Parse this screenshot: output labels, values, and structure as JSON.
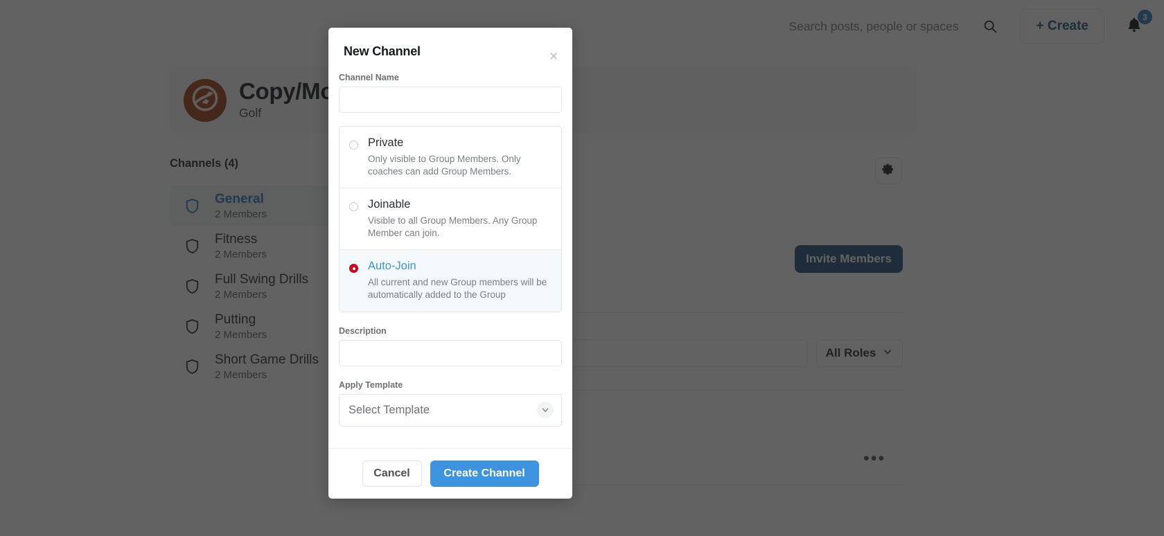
{
  "topbar": {
    "search_placeholder": "Search posts, people or spaces",
    "search_value": "",
    "search_icon": "search-icon",
    "create_label": "+ Create",
    "bell_icon": "bell-icon",
    "notification_count": "3",
    "badge_color": "#2c75b8"
  },
  "group": {
    "title": "Copy/Mov",
    "subtitle": "Golf",
    "logo_icon": "runner-logo-icon",
    "logo_color": "#a23c12"
  },
  "channels_panel": {
    "heading": "Channels (4)",
    "items": [
      {
        "name": "General",
        "members": "2 Members",
        "icon": "shield-icon",
        "active": true
      },
      {
        "name": "Fitness",
        "members": "2 Members",
        "icon": "shield-icon",
        "active": false
      },
      {
        "name": "Full Swing Drills",
        "members": "2 Members",
        "icon": "shield-icon",
        "active": false
      },
      {
        "name": "Putting",
        "members": "2 Members",
        "icon": "shield-icon",
        "active": false
      },
      {
        "name": "Short Game Drills",
        "members": "2 Members",
        "icon": "shield-icon",
        "active": false
      }
    ]
  },
  "members_panel": {
    "gear_icon": "gear-icon",
    "invite_label": "Invite Members",
    "invite_color": "#1f4e79",
    "search_value": "",
    "roles_label": "All Roles",
    "roles_chevron_icon": "chevron-down-icon",
    "row_menu_label": "•••"
  },
  "modal": {
    "title": "New Channel",
    "close_icon": "close-icon",
    "close_label": "×",
    "channel_name": {
      "label": "Channel Name",
      "value": "",
      "placeholder": ""
    },
    "visibility_options": [
      {
        "title": "Private",
        "description": "Only visible to Group Members. Only coaches can add Group Members.",
        "selected": false
      },
      {
        "title": "Joinable",
        "description": "Visible to all Group Members. Any Group Member can join.",
        "selected": false
      },
      {
        "title": "Auto-Join",
        "description": "All current and new Group members will be automatically added to the Group",
        "selected": true
      }
    ],
    "selected_radio_color": "#d0021b",
    "selected_title_color": "#3d93dd",
    "description": {
      "label": "Description",
      "value": "",
      "placeholder": ""
    },
    "apply_template": {
      "label": "Apply Template",
      "selected": "Select Template",
      "chevron_icon": "chevron-down-icon"
    },
    "cancel_label": "Cancel",
    "create_label": "Create Channel",
    "create_color": "#3d93dd"
  }
}
